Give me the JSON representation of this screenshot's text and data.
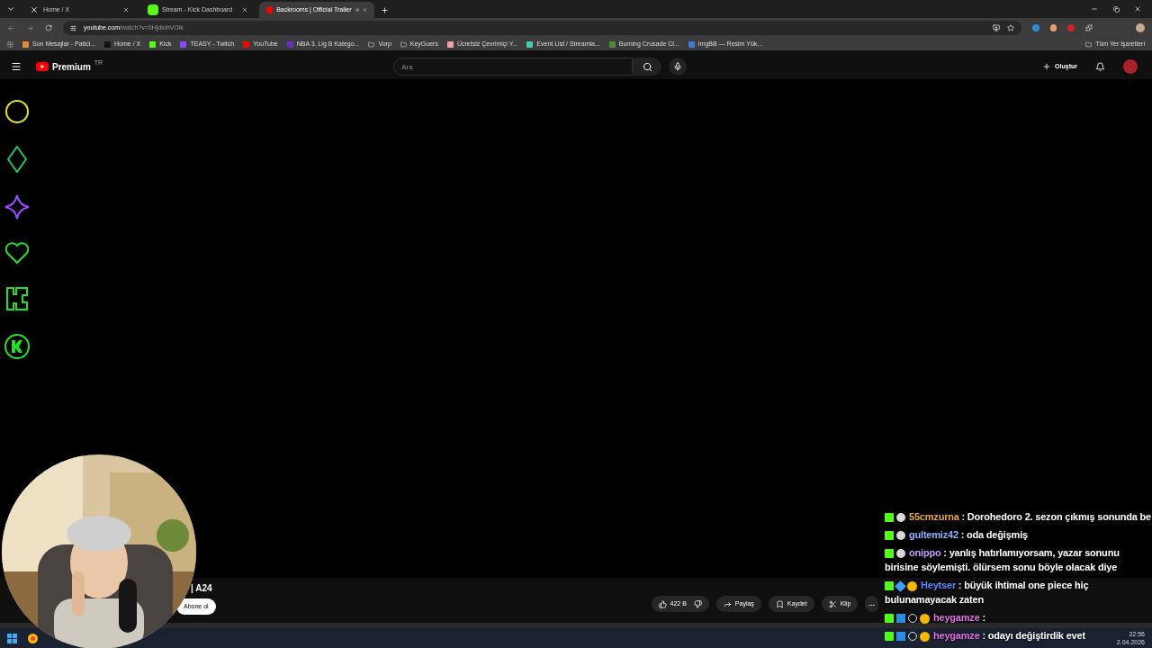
{
  "browser": {
    "tabs": [
      {
        "title": "Home / X",
        "kind": "x",
        "selected": false,
        "audio": false
      },
      {
        "title": "Stream - Kick Dashboard",
        "kind": "kick",
        "selected": false,
        "audio": false
      },
      {
        "title": "Backrooms | Official Trailer",
        "kind": "youtube",
        "selected": true,
        "audio": true
      }
    ],
    "url_host": "youtube.com",
    "url_path": "/watch?v=0HjdiohVOik",
    "bookmarks": [
      {
        "label": "Son Mesajlar - Patici...",
        "kind": "site",
        "color": "#e8893a"
      },
      {
        "label": "Home / X",
        "kind": "site",
        "color": "#111111"
      },
      {
        "label": "Kick",
        "kind": "site",
        "color": "#53fc18"
      },
      {
        "label": "TEASY - Twitch",
        "kind": "site",
        "color": "#9146ff"
      },
      {
        "label": "YouTube",
        "kind": "site",
        "color": "#ff0000"
      },
      {
        "label": "NBA 3. Lig B Katego...",
        "kind": "site",
        "color": "#6b2fbf"
      },
      {
        "label": "Vorp",
        "kind": "folder"
      },
      {
        "label": "KeyGuers",
        "kind": "folder"
      },
      {
        "label": "Ücretsiz Çevrimiçi Y...",
        "kind": "site",
        "color": "#f0a0b0"
      },
      {
        "label": "Event List / Streamla...",
        "kind": "site",
        "color": "#3fd0b0"
      },
      {
        "label": "Burning Crusade Cl...",
        "kind": "site",
        "color": "#4a8a3a"
      },
      {
        "label": "ImgBB — Resim Yük...",
        "kind": "site",
        "color": "#3a7bd5"
      }
    ],
    "all_bookmarks": "Tüm Yer İşaretleri"
  },
  "youtube": {
    "logo": "Premium",
    "region": "TR",
    "search": {
      "placeholder": "Ara"
    },
    "create": "Oluştur",
    "channel_fragment": "| A24",
    "subscribe": "Abone ol",
    "likes": "422 B",
    "share": "Paylaş",
    "save": "Kaydet",
    "clip": "Klip",
    "more": "..."
  },
  "overlay_icons": [
    {
      "kind": "circle",
      "color": "#e8e020"
    },
    {
      "kind": "diamond",
      "color": "#22c55e"
    },
    {
      "kind": "star",
      "color": "#9b4dff"
    },
    {
      "kind": "heart",
      "color": "#22e022"
    },
    {
      "kind": "k-square",
      "color": "#22e022"
    },
    {
      "kind": "k-circle",
      "color": "#22e022"
    }
  ],
  "chat": [
    {
      "badges": [
        {
          "kind": "kick"
        },
        {
          "kind": "emote"
        }
      ],
      "user": "55cmzurna",
      "color": "#e8a33a",
      "text": ": Dorohedoro 2. sezon çıkmış sonunda be"
    },
    {
      "badges": [
        {
          "kind": "kick"
        },
        {
          "kind": "emote"
        }
      ],
      "user": "gultemiz42",
      "color": "#8fb4ff",
      "text": ": oda değişmiş"
    },
    {
      "badges": [
        {
          "kind": "kick"
        },
        {
          "kind": "emote"
        }
      ],
      "user": "onippo",
      "color": "#c89bff",
      "text": ": yanlış hatırlamıyorsam, yazar sonunu birisine söylemişti. ölürsem sonu böyle olacak diye"
    },
    {
      "badges": [
        {
          "kind": "kick"
        },
        {
          "kind": "cube"
        },
        {
          "kind": "sub"
        }
      ],
      "user": "Heytser",
      "color": "#5a8cff",
      "text": ": büyük ihtimal one piece hiç bulunamayacak zaten"
    },
    {
      "badges": [
        {
          "kind": "kick"
        },
        {
          "kind": "tool"
        },
        {
          "kind": "bike"
        },
        {
          "kind": "sub"
        }
      ],
      "user": "heygamze",
      "color": "#e070e0",
      "text": ":"
    },
    {
      "badges": [
        {
          "kind": "kick"
        },
        {
          "kind": "tool"
        },
        {
          "kind": "bike"
        },
        {
          "kind": "sub"
        }
      ],
      "user": "heygamze",
      "color": "#e070e0",
      "text": ": odayı değiştirdik evet"
    }
  ],
  "taskbar": {
    "time": "22:56",
    "date": "2.04.2026"
  }
}
